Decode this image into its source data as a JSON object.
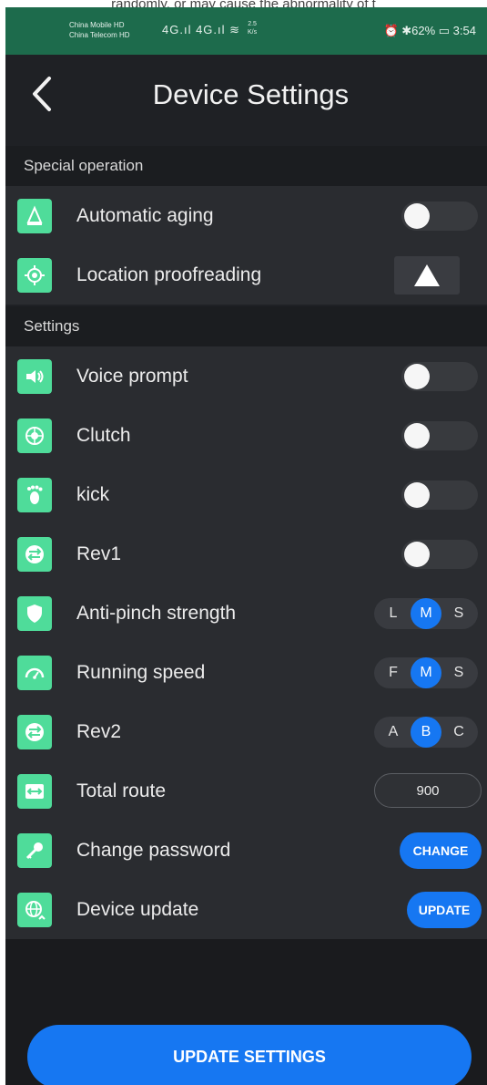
{
  "top_caption": "randomly, or may cause the abnormality of t",
  "status_bar": {
    "carrier1": "China Mobile HD",
    "carrier2": "China Telecom HD",
    "signal": "4G.ıl 4G.ıl ≋",
    "net_speed_value": "2.5",
    "net_speed_unit": "K/s",
    "right": "⏰ ✱62% ▭ 3:54"
  },
  "header": {
    "title": "Device Settings"
  },
  "sections": {
    "special": "Special operation",
    "settings": "Settings"
  },
  "rows": {
    "aging": {
      "label": "Automatic aging",
      "icon": "aging-icon",
      "on": false
    },
    "location": {
      "label": "Location proofreading",
      "icon": "target-icon"
    },
    "voice": {
      "label": "Voice prompt",
      "icon": "speaker-icon",
      "on": false
    },
    "clutch": {
      "label": "Clutch",
      "icon": "clutch-icon",
      "on": false
    },
    "kick": {
      "label": "kick",
      "icon": "foot-icon",
      "on": false
    },
    "rev1": {
      "label": "Rev1",
      "icon": "swap-icon",
      "on": false
    },
    "anti_pinch": {
      "label": "Anti-pinch strength",
      "icon": "shield-icon",
      "options": [
        "L",
        "M",
        "S"
      ],
      "selected": "M"
    },
    "running_speed": {
      "label": "Running speed",
      "icon": "speedometer-icon",
      "options": [
        "F",
        "M",
        "S"
      ],
      "selected": "M"
    },
    "rev2": {
      "label": "Rev2",
      "icon": "swap-icon",
      "options": [
        "A",
        "B",
        "C"
      ],
      "selected": "B"
    },
    "total_route": {
      "label": "Total route",
      "icon": "route-icon",
      "value": "900"
    },
    "change_password": {
      "label": "Change password",
      "icon": "key-icon",
      "button": "CHANGE"
    },
    "device_update": {
      "label": "Device update",
      "icon": "globe-icon",
      "button": "UPDATE"
    }
  },
  "footer": {
    "button": "UPDATE SETTINGS"
  },
  "colors": {
    "accent": "#1677f2",
    "icon_bg": "#4fdc9a",
    "status_bar": "#1d6b4c",
    "background": "#1f2125"
  }
}
